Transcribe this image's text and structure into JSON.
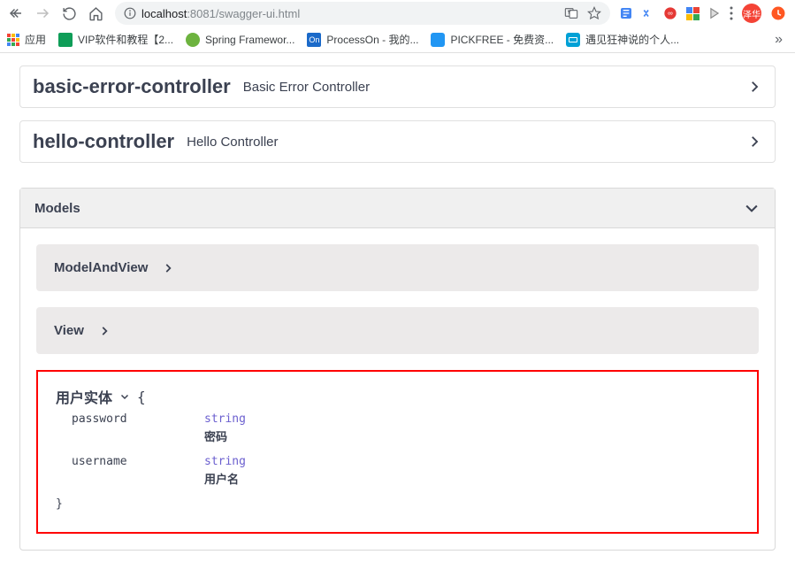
{
  "browser": {
    "url_host": "localhost",
    "url_port_path": ":8081/swagger-ui.html",
    "translate_icon": "translate-icon",
    "star_icon": "star-icon"
  },
  "bookmarks": {
    "apps": "应用",
    "items": [
      {
        "label": "VIP软件和教程【2...",
        "color": "#0f9d58"
      },
      {
        "label": "Spring Framewor...",
        "color": "#6db33f"
      },
      {
        "label": "ProcessOn - 我的...",
        "color": "#1b6ac9"
      },
      {
        "label": "PICKFREE - 免费资...",
        "color": "#2196f3"
      },
      {
        "label": "遇见狂神说的个人...",
        "color": "#00a1d6"
      }
    ]
  },
  "controllers": [
    {
      "name": "basic-error-controller",
      "desc": "Basic Error Controller"
    },
    {
      "name": "hello-controller",
      "desc": "Hello Controller"
    }
  ],
  "models": {
    "header": "Models",
    "collapsed": [
      {
        "name": "ModelAndView"
      },
      {
        "name": "View"
      }
    ],
    "expanded": {
      "name": "用户实体",
      "open": "{",
      "close": "}",
      "properties": [
        {
          "key": "password",
          "type": "string",
          "desc": "密码"
        },
        {
          "key": "username",
          "type": "string",
          "desc": "用户名"
        }
      ]
    }
  },
  "avatar_text": "泽华"
}
